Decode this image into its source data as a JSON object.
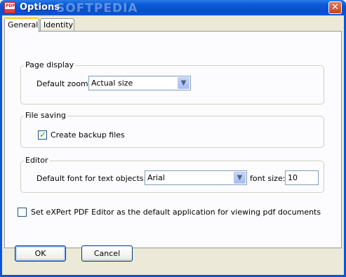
{
  "window": {
    "title": "Options",
    "close_label": "✕"
  },
  "tabs": [
    {
      "label": "General",
      "active": true
    },
    {
      "label": "Identity",
      "active": false
    }
  ],
  "page_display": {
    "title": "Page display",
    "zoom_label": "Default zoom:",
    "zoom_value": "Actual size"
  },
  "file_saving": {
    "title": "File saving",
    "backup_label": "Create backup files",
    "backup_checked": true
  },
  "editor": {
    "title": "Editor",
    "font_label": "Default font for text objects:",
    "font_value": "Arial",
    "size_label": "font size:",
    "size_value": "10"
  },
  "default_app": {
    "label": "Set eXPert PDF Editor as the default application for viewing pdf documents",
    "checked": false
  },
  "buttons": {
    "ok": "OK",
    "cancel": "Cancel"
  },
  "watermark": "SOFTPEDIA"
}
